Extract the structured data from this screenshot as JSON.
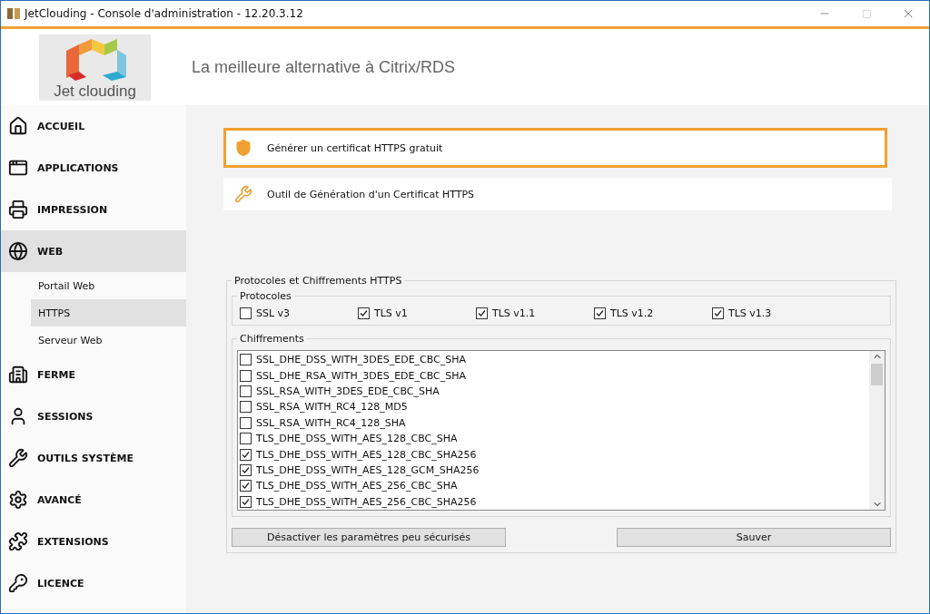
{
  "window": {
    "title": "JetClouding - Console d'administration - 12.20.3.12"
  },
  "header": {
    "logo_text": "Jet clouding",
    "tagline": "La meilleure alternative à Citrix/RDS"
  },
  "sidebar": {
    "items": [
      {
        "label": "ACCUEIL",
        "selected": false
      },
      {
        "label": "APPLICATIONS",
        "selected": false
      },
      {
        "label": "IMPRESSION",
        "selected": false
      },
      {
        "label": "WEB",
        "selected": true,
        "children": [
          {
            "label": "Portail Web",
            "selected": false
          },
          {
            "label": "HTTPS",
            "selected": true
          },
          {
            "label": "Serveur Web",
            "selected": false
          }
        ]
      },
      {
        "label": "FERME",
        "selected": false
      },
      {
        "label": "SESSIONS",
        "selected": false
      },
      {
        "label": "OUTILS SYSTÈME",
        "selected": false
      },
      {
        "label": "AVANCÉ",
        "selected": false
      },
      {
        "label": "EXTENSIONS",
        "selected": false
      },
      {
        "label": "LICENCE",
        "selected": false
      }
    ]
  },
  "actions": [
    {
      "label": "Générer un certificat HTTPS gratuit",
      "selected": true
    },
    {
      "label": "Outil de Génération d'un Certificat HTTPS",
      "selected": false
    }
  ],
  "https_group": {
    "title": "Protocoles et Chiffrements HTTPS",
    "protocols": {
      "title": "Protocoles",
      "items": [
        {
          "label": "SSL v3",
          "checked": false
        },
        {
          "label": "TLS v1",
          "checked": true
        },
        {
          "label": "TLS v1.1",
          "checked": true
        },
        {
          "label": "TLS v1.2",
          "checked": true
        },
        {
          "label": "TLS v1.3",
          "checked": true
        }
      ]
    },
    "ciphers": {
      "title": "Chiffrements",
      "items": [
        {
          "label": "SSL_DHE_DSS_WITH_3DES_EDE_CBC_SHA",
          "checked": false
        },
        {
          "label": "SSL_DHE_RSA_WITH_3DES_EDE_CBC_SHA",
          "checked": false
        },
        {
          "label": "SSL_RSA_WITH_3DES_EDE_CBC_SHA",
          "checked": false
        },
        {
          "label": "SSL_RSA_WITH_RC4_128_MD5",
          "checked": false
        },
        {
          "label": "SSL_RSA_WITH_RC4_128_SHA",
          "checked": false
        },
        {
          "label": "TLS_DHE_DSS_WITH_AES_128_CBC_SHA",
          "checked": false
        },
        {
          "label": "TLS_DHE_DSS_WITH_AES_128_CBC_SHA256",
          "checked": true
        },
        {
          "label": "TLS_DHE_DSS_WITH_AES_128_GCM_SHA256",
          "checked": true
        },
        {
          "label": "TLS_DHE_DSS_WITH_AES_256_CBC_SHA",
          "checked": true
        },
        {
          "label": "TLS_DHE_DSS_WITH_AES_256_CBC_SHA256",
          "checked": true
        }
      ]
    },
    "buttons": [
      "Désactiver les paramètres peu sécurisés",
      "Sauver"
    ]
  }
}
